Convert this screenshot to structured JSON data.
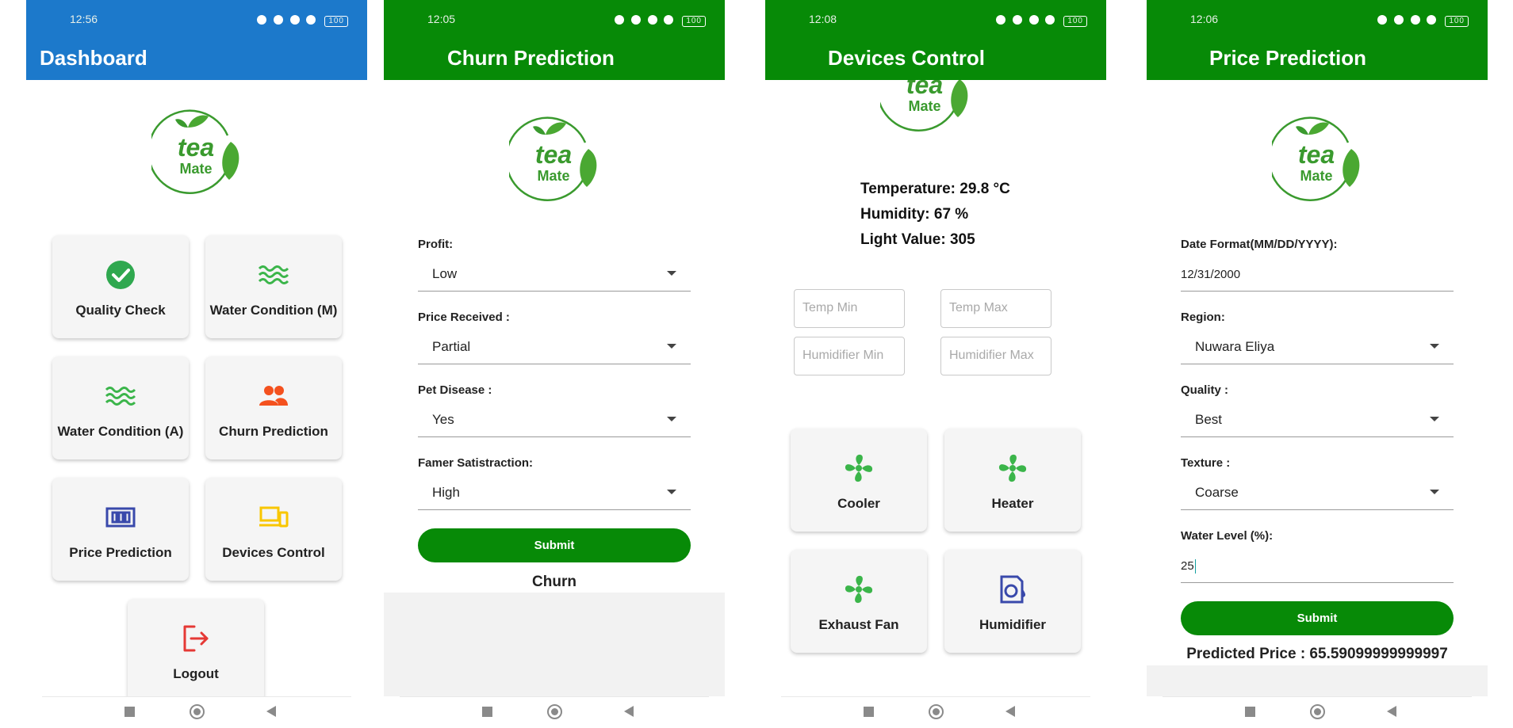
{
  "dashboard": {
    "status_time": "12:56",
    "title": "Dashboard",
    "logo": {
      "line1": "tea",
      "line2": "Mate"
    },
    "tiles": [
      {
        "label": "Quality Check",
        "icon": "check-circle-icon",
        "color": "#2fa84f"
      },
      {
        "label": "Water Condition (M)",
        "icon": "waves-icon",
        "color": "#3bb54a"
      },
      {
        "label": "Water Condition (A)",
        "icon": "waves-icon",
        "color": "#3bb54a"
      },
      {
        "label": "Churn Prediction",
        "icon": "people-icon",
        "color": "#f4511e"
      },
      {
        "label": "Price Prediction",
        "icon": "price-icon",
        "color": "#3949ab"
      },
      {
        "label": "Devices Control",
        "icon": "devices-icon",
        "color": "#f9c600"
      },
      {
        "label": "Logout",
        "icon": "logout-icon",
        "color": "#e53935"
      }
    ]
  },
  "churn": {
    "status_time": "12:05",
    "title": "Churn Prediction",
    "fields": [
      {
        "label": "Profit:",
        "value": "Low"
      },
      {
        "label": "Price Received :",
        "value": "Partial"
      },
      {
        "label": "Pet Disease :",
        "value": "Yes"
      },
      {
        "label": "Famer Satistraction:",
        "value": "High"
      }
    ],
    "submit_label": "Submit",
    "result": "Churn"
  },
  "devices": {
    "status_time": "12:08",
    "title": "Devices Control",
    "readings": {
      "temperature": "Temperature: 29.8 °C",
      "humidity": "Humidity: 67 %",
      "light": "Light Value: 305"
    },
    "inputs": {
      "temp_min": "Temp Min",
      "temp_max": "Temp Max",
      "humidifier_min": "Humidifier Min",
      "humidifier_max": "Humidifier Max"
    },
    "tiles": [
      {
        "label": "Cooler",
        "icon": "fan-icon",
        "color": "#3bb54a"
      },
      {
        "label": "Heater",
        "icon": "fan-icon",
        "color": "#3bb54a"
      },
      {
        "label": "Exhaust Fan",
        "icon": "fan-icon",
        "color": "#3bb54a"
      },
      {
        "label": "Humidifier",
        "icon": "humidifier-icon",
        "color": "#3949ab"
      }
    ]
  },
  "price": {
    "status_time": "12:06",
    "title": "Price Prediction",
    "date_label": "Date Format(MM/DD/YYYY):",
    "date_value": "12/31/2000",
    "region_label": "Region:",
    "region_value": "Nuwara Eliya",
    "quality_label": "Quality :",
    "quality_value": "Best",
    "texture_label": "Texture :",
    "texture_value": "Coarse",
    "water_label": "Water Level (%):",
    "water_value": "25",
    "submit_label": "Submit",
    "result": "Predicted Price : 65.59099999999997"
  },
  "status_bar": {
    "battery": "100"
  }
}
